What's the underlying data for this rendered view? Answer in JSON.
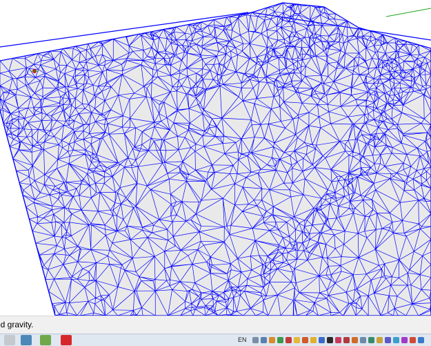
{
  "status_bar": {
    "text": "nd gravity."
  },
  "tray": {
    "language": "EN"
  },
  "colors": {
    "mesh": "#0000ff",
    "surface": "#e9e9ea",
    "axis_green": "#1aa51a",
    "axis_red": "#d01818"
  },
  "taskbar": {
    "apps": [
      {
        "icon": "file-explorer-icon",
        "color": "#c4c9cf"
      },
      {
        "icon": "monitor-app-icon",
        "color": "#4d88b8"
      },
      {
        "icon": "notepad-app-icon",
        "color": "#6ea84b"
      },
      {
        "icon": "sketchup-app-icon",
        "color": "#d6282a"
      }
    ],
    "tray_icons": [
      {
        "icon": "tray-app-icon",
        "color": "#7a8ea6"
      },
      {
        "icon": "tray-app-icon",
        "color": "#5a7fb0"
      },
      {
        "icon": "tray-app-icon",
        "color": "#d98c2a"
      },
      {
        "icon": "tray-app-icon",
        "color": "#3a9a4a"
      },
      {
        "icon": "tray-app-icon",
        "color": "#c23a3a"
      },
      {
        "icon": "tray-app-icon",
        "color": "#e2b93a"
      },
      {
        "icon": "tray-app-icon",
        "color": "#d05a2a"
      },
      {
        "icon": "tray-app-icon",
        "color": "#e0b030"
      },
      {
        "icon": "tray-app-icon",
        "color": "#3a6ac8"
      },
      {
        "icon": "tray-app-icon",
        "color": "#2a2a2a"
      },
      {
        "icon": "tray-app-icon",
        "color": "#c83a5a"
      },
      {
        "icon": "tray-app-icon",
        "color": "#b03a3a"
      },
      {
        "icon": "tray-app-icon",
        "color": "#d06a2a"
      },
      {
        "icon": "tray-app-icon",
        "color": "#6a8aa8"
      },
      {
        "icon": "tray-app-icon",
        "color": "#3a8a6a"
      },
      {
        "icon": "tray-app-icon",
        "color": "#c8a23a"
      },
      {
        "icon": "tray-app-icon",
        "color": "#5a5ac8"
      },
      {
        "icon": "tray-app-icon",
        "color": "#3aa0c8"
      },
      {
        "icon": "tray-app-icon",
        "color": "#a03ac8"
      },
      {
        "icon": "tray-app-icon",
        "color": "#d04a3a"
      },
      {
        "icon": "tray-app-icon",
        "color": "#3a7ac8"
      }
    ]
  }
}
